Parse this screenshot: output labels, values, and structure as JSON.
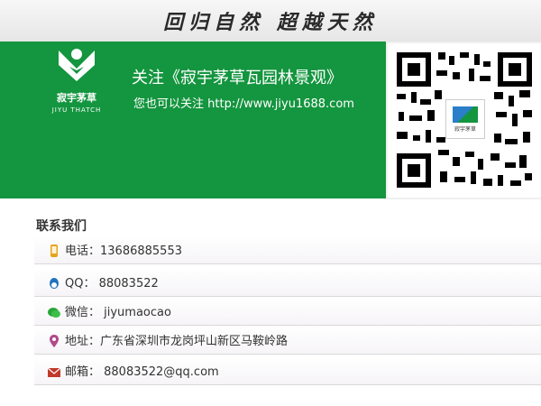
{
  "banner": {
    "slogan": "回归自然 超越天然"
  },
  "brand": {
    "name_cn": "寂宇茅草",
    "name_en": "JIYU THATCH"
  },
  "follow": {
    "title": "关注《寂宇茅草瓦园林景观》",
    "subtitle": "您也可以关注 http://www.jiyu1688.com"
  },
  "qr": {
    "center_label": "寂宇茅草"
  },
  "contact": {
    "title": "联系我们",
    "rows": [
      {
        "icon": "phone-icon",
        "text": "电话：13686885553"
      },
      {
        "icon": "qq-icon",
        "text": "QQ：  88083522"
      },
      {
        "icon": "wechat-icon",
        "text": "微信：  jiyumaocao"
      },
      {
        "icon": "location-pin-icon",
        "text": "地址：广东省深圳市龙岗坪山新区马鞍岭路"
      },
      {
        "icon": "mail-icon",
        "text": "邮箱：  88083522@qq.com"
      }
    ]
  },
  "colors": {
    "brand_green": "#14953f",
    "icon_orange": "#e8a21b",
    "icon_blue": "#1e73be",
    "icon_wechat": "#2aa43a",
    "icon_red": "#c0392b"
  }
}
